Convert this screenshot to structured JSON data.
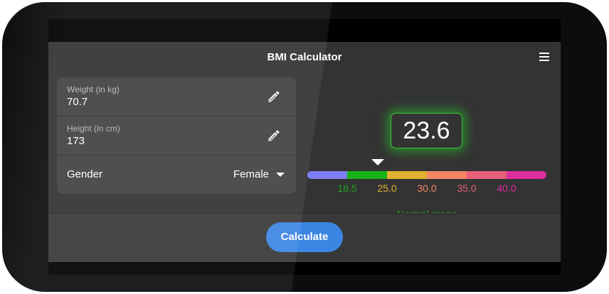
{
  "app": {
    "title": "BMI Calculator"
  },
  "inputs": {
    "weight": {
      "label": "Weight (in kg)",
      "value": "70.7"
    },
    "height": {
      "label": "Height (in cm)",
      "value": "173"
    },
    "gender": {
      "label": "Gender",
      "value": "Female"
    }
  },
  "result": {
    "bmi": "23.6",
    "range_label": "Normal range",
    "range_color": "#1ea31e"
  },
  "scale": {
    "min": 12.9,
    "max": 46.5,
    "segments": [
      {
        "color": "#7e7ef5"
      },
      {
        "color": "#17b217"
      },
      {
        "color": "#e0b130"
      },
      {
        "color": "#f48663"
      },
      {
        "color": "#e8607a"
      },
      {
        "color": "#dd2e9c"
      }
    ],
    "ticks": [
      {
        "label": "18.5",
        "color": "#1ea31e"
      },
      {
        "label": "25.0",
        "color": "#e0b130"
      },
      {
        "label": "30.0",
        "color": "#f48663"
      },
      {
        "label": "35.0",
        "color": "#e8607a"
      },
      {
        "label": "40.0",
        "color": "#dd2e9c"
      }
    ]
  },
  "actions": {
    "calculate_label": "Calculate"
  },
  "icons": {
    "menu": "menu-icon",
    "edit": "pencil-icon",
    "dropdown": "caret-down-icon"
  }
}
